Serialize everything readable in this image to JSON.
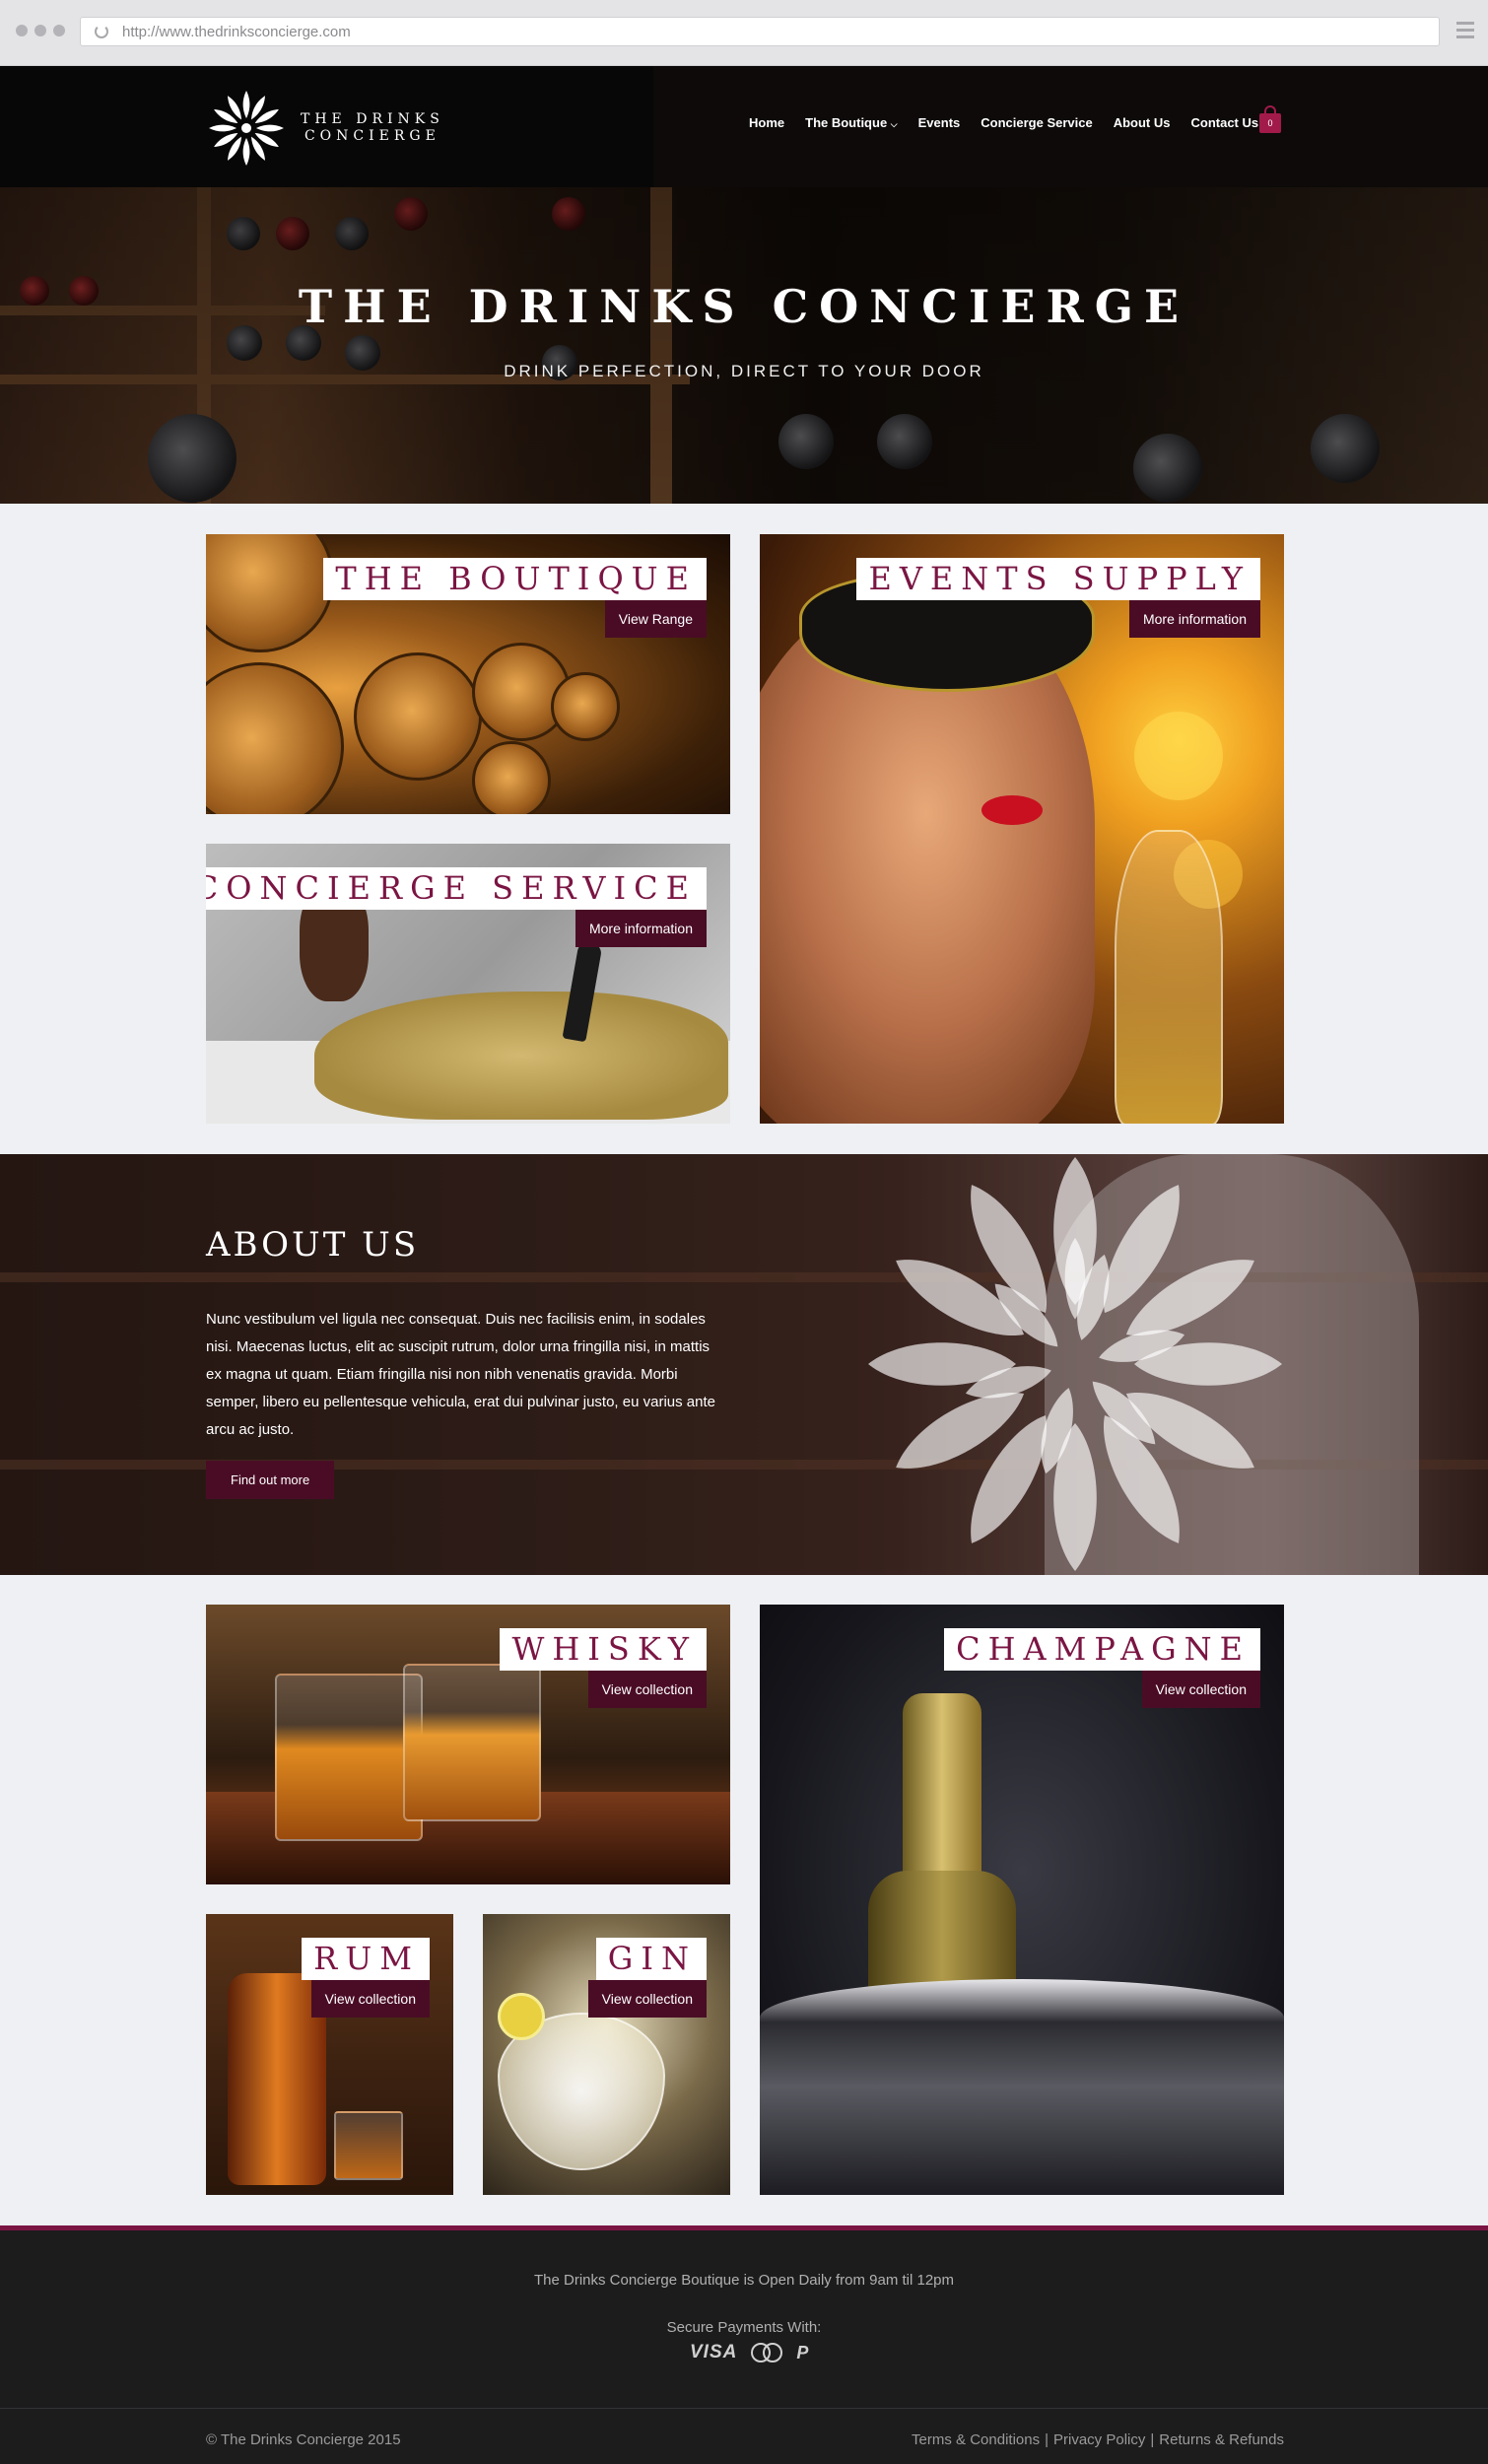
{
  "browser": {
    "url": "http://www.thedrinksconcierge.com"
  },
  "header": {
    "logo_line1": "THE DRINKS",
    "logo_line2": "CONCIERGE",
    "nav": [
      {
        "label": "Home"
      },
      {
        "label": "The Boutique",
        "icon": "chevron-down-icon"
      },
      {
        "label": "Events"
      },
      {
        "label": "Concierge Service"
      },
      {
        "label": "About Us"
      },
      {
        "label": "Contact Us"
      }
    ],
    "cart_count": "0",
    "cart_icon": "shopping-bag-icon"
  },
  "hero": {
    "title": "THE DRINKS CONCIERGE",
    "subtitle": "DRINK PERFECTION, DIRECT TO YOUR DOOR"
  },
  "tiles": {
    "boutique": {
      "title": "THE BOUTIQUE",
      "button": "View Range"
    },
    "events": {
      "title": "EVENTS SUPPLY",
      "button": "More information"
    },
    "concierge": {
      "title": "CONCIERGE SERVICE",
      "button": "More information"
    },
    "whisky": {
      "title": "WHISKY",
      "button": "View collection"
    },
    "champagne": {
      "title": "CHAMPAGNE",
      "button": "View collection"
    },
    "rum": {
      "title": "RUM",
      "button": "View collection"
    },
    "gin": {
      "title": "GIN",
      "button": "View collection"
    }
  },
  "about": {
    "title": "ABOUT US",
    "body": "Nunc vestibulum vel ligula nec consequat. Duis nec facilisis enim, in sodales nisi. Maecenas luctus, elit ac suscipit rutrum, dolor urna fringilla nisi, in mattis ex magna ut quam. Etiam fringilla nisi non nibh venenatis gravida. Morbi semper, libero eu pellentesque vehicula, erat dui pulvinar justo, eu varius ante arcu ac justo.",
    "button": "Find out more"
  },
  "footer": {
    "hours": "The Drinks Concierge Boutique is Open Daily from 9am til 12pm",
    "payments_label": "Secure Payments With:",
    "visa": "VISA",
    "paypal": "P",
    "copyright": "© The Drinks Concierge 2015",
    "links": [
      "Terms & Conditions",
      "Privacy Policy",
      "Returns & Refunds"
    ],
    "separator": "|"
  },
  "colors": {
    "accent": "#7a1543",
    "button_bg": "#4a0c25",
    "header_bg": "#0d0a09",
    "footer_bg": "#1c1c1d"
  }
}
